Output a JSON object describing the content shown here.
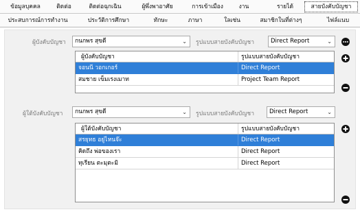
{
  "tabs_row1": [
    {
      "label": "ข้อมูลบุคคล"
    },
    {
      "label": "ติดต่อ"
    },
    {
      "label": "ติดต่อฉุกเฉิน"
    },
    {
      "label": "ผู้พึ่งพาอาศัย"
    },
    {
      "label": "การเข้าเมือง"
    },
    {
      "label": "งาน"
    },
    {
      "label": "รายได้"
    },
    {
      "label": "สายบังคับบัญชา",
      "active": true
    }
  ],
  "tabs_row2": [
    {
      "label": "ประสบการณ์การทำงาน"
    },
    {
      "label": "ประวัติการศึกษา"
    },
    {
      "label": "ทักษะ"
    },
    {
      "label": "ภาษา"
    },
    {
      "label": "ใลเซ่น"
    },
    {
      "label": "สมาชิกในที่ต่างๆ"
    },
    {
      "label": "ไฟล์แนบ"
    }
  ],
  "supervisor_section": {
    "name_label": "ผู้บังคับบัญชา",
    "name_value": "กนกพร สุขดี",
    "type_label": "รูปแบบสายบังคับบัญชา",
    "type_value": "Direct Report",
    "columns": [
      "ผู้บังคับบัญชา",
      "รูปแบบสายบังคับบัญชา"
    ],
    "rows": [
      {
        "name": "จอนนี วอกเกอร์",
        "type": "Direct Report",
        "selected": true
      },
      {
        "name": "สมชาย เข็มเรงเมาท",
        "type": "Project Team Report",
        "selected": false
      }
    ]
  },
  "subordinate_section": {
    "name_label": "ผู้ใต้บังคับบัญชา",
    "name_value": "กนกพร สุขดี",
    "type_label": "รูปแบบสายบังคับบัญชา",
    "type_value": "Direct Report",
    "columns": [
      "ผู้ใต้บังคับบัญชา",
      "รูปแบบสายบังคับบัญชา"
    ],
    "rows": [
      {
        "name": "สรยุทธ อยู่ไหนจ๊ะ",
        "type": "Direct Report",
        "selected": true
      },
      {
        "name": "คิดถึง พ่อของเรา",
        "type": "Direct Report",
        "selected": false
      },
      {
        "name": "ทุเรียน ตะมุตะมิ",
        "type": "Direct Report",
        "selected": false
      }
    ]
  },
  "icons": {
    "more": "ellipsis-circle-icon",
    "add": "plus-circle-icon",
    "remove": "minus-circle-icon",
    "dropdown": "chevron-down-icon"
  },
  "colors": {
    "selected_row": "#2f7fd8",
    "panel_bg": "#f1f1f1",
    "label_text": "#7a7a7a"
  }
}
